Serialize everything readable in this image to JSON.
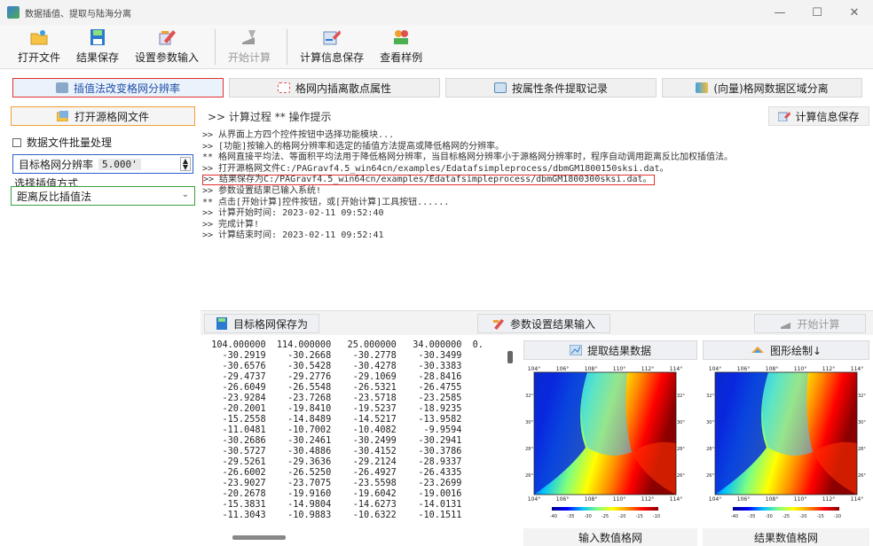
{
  "window": {
    "title": "数据插值、提取与陆海分离",
    "controls": [
      "—",
      "☐",
      "✕"
    ]
  },
  "toolbar": {
    "items": [
      {
        "label": "打开文件",
        "icon": "open-folder-icon"
      },
      {
        "label": "结果保存",
        "icon": "save-disk-icon"
      },
      {
        "label": "设置参数输入",
        "icon": "settings-pen-icon"
      },
      {
        "label": "开始计算",
        "icon": "compute-icon",
        "disabled": true
      },
      {
        "label": "计算信息保存",
        "icon": "info-save-icon"
      },
      {
        "label": "查看样例",
        "icon": "sample-view-icon"
      }
    ]
  },
  "modes": [
    {
      "label": "插值法改变格网分辨率",
      "active": true
    },
    {
      "label": "格网内插离散点属性",
      "active": false
    },
    {
      "label": "按属性条件提取记录",
      "active": false
    },
    {
      "label": "(向量)格网数据区域分离",
      "active": false
    }
  ],
  "left": {
    "open_source_grid": "打开源格网文件",
    "batch_label": "数据文件批量处理",
    "target_res_label": "目标格网分辨率",
    "target_res_value": "5.000'",
    "method_label": "选择插值方式",
    "method_value": "距离反比插值法"
  },
  "right_header": {
    "tabs": ">> 计算过程   ** 操作提示",
    "save_log": "计算信息保存"
  },
  "log": [
    ">> 从界面上方四个控件按钮中选择功能模块...",
    ">> [功能]按输入的格网分辨率和选定的插值方法提高或降低格网的分辨率。",
    "  ** 格网直接平均法、等面积平均法用于降低格网分辨率，当目标格网分辨率小于源格网分辨率时，程序自动调用距离反比加权插值法。",
    ">> 打开源格网文件C:/PAGravf4.5_win64cn/examples/Edatafsimpleprocess/dbmGM1800150sksi.dat。",
    ">> 结果保存为C:/PAGravf4.5_win64cn/examples/Edatafsimpleprocess/dbmGM1800300sksi.dat。",
    ">> 参数设置结果已输入系统!",
    "  ** 点击[开始计算]控件按钮，或[开始计算]工具按钮......",
    ">> 计算开始时间: 2023-02-11 09:52:40",
    ">> 完成计算!",
    ">> 计算结束时间: 2023-02-11 09:52:41"
  ],
  "lower_bar": {
    "save_target": "目标格网保存为",
    "param_input": "参数设置结果输入",
    "start": "开始计算"
  },
  "table_rows": [
    "  104.000000  114.000000   25.000000   34.000000  0.",
    "    -30.2919    -30.2668    -30.2778    -30.3499",
    "    -30.6576    -30.5428    -30.4278    -30.3383",
    "    -29.4737    -29.2776    -29.1069    -28.8416",
    "    -26.6049    -26.5548    -26.5321    -26.4755",
    "    -23.9284    -23.7268    -23.5718    -23.2585",
    "    -20.2001    -19.8410    -19.5237    -18.9235",
    "    -15.2558    -14.8489    -14.5217    -13.9582",
    "    -11.0481    -10.7002    -10.4082     -9.9594",
    "    -30.2686    -30.2461    -30.2499    -30.2941",
    "    -30.5727    -30.4886    -30.4152    -30.3786",
    "    -29.5261    -29.3636    -29.2124    -28.9337",
    "    -26.6002    -26.5250    -26.4927    -26.4335",
    "    -23.9027    -23.7075    -23.5598    -23.2699",
    "    -20.2678    -19.9160    -19.6042    -19.0016",
    "    -15.3831    -14.9804    -14.6273    -14.0131",
    "    -11.3043    -10.9883    -10.6322    -10.1511"
  ],
  "plots": {
    "extract_btn": "提取结果数据",
    "draw_btn": "图形绘制↓",
    "cap_input": "输入数值格网",
    "cap_result": "结果数值格网",
    "x_ticks": [
      "104°",
      "106°",
      "108°",
      "110°",
      "112°",
      "114°"
    ],
    "y_ticks": [
      "32°",
      "30°",
      "28°",
      "26°"
    ],
    "colorbar_ticks": [
      "-40",
      "-35",
      "-30",
      "-25",
      "-20",
      "-15",
      "-10"
    ],
    "colormap": [
      "#00008b",
      "#0000ff",
      "#00bfff",
      "#7fff7f",
      "#ffff00",
      "#ff8c00",
      "#ff0000",
      "#8b0000"
    ]
  }
}
